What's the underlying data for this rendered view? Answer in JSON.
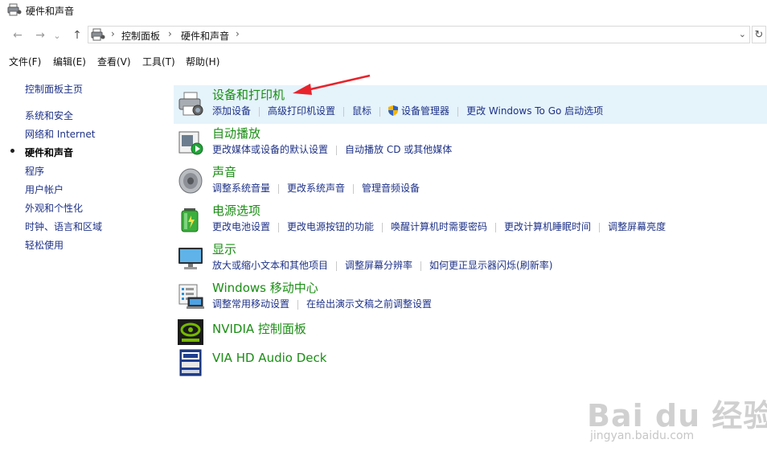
{
  "window": {
    "title": "硬件和声音",
    "title_icon": "printer-speaker-icon"
  },
  "nav": {
    "back_icon": "←",
    "forward_icon": "→",
    "recent_icon": "⌄",
    "up_icon": "↑",
    "breadcrumb": [
      "控制面板",
      "硬件和声音"
    ],
    "chevron": "›",
    "dropdown_icon": "⌄",
    "refresh_icon": "↻"
  },
  "menu": {
    "items": [
      "文件(F)",
      "编辑(E)",
      "查看(V)",
      "工具(T)",
      "帮助(H)"
    ]
  },
  "sidebar": {
    "items": [
      {
        "label": "控制面板主页"
      },
      {
        "label": "系统和安全"
      },
      {
        "label": "网络和 Internet"
      },
      {
        "label": "硬件和声音",
        "active": true
      },
      {
        "label": "程序"
      },
      {
        "label": "用户帐户"
      },
      {
        "label": "外观和个性化"
      },
      {
        "label": "时钟、语言和区域"
      },
      {
        "label": "轻松使用"
      }
    ]
  },
  "categories": [
    {
      "title": "设备和打印机",
      "icon": "printer-camera-icon",
      "links": [
        "添加设备",
        "高级打印机设置",
        "鼠标",
        "设备管理器",
        "更改 Windows To Go 启动选项"
      ]
    },
    {
      "title": "自动播放",
      "icon": "autoplay-icon",
      "links": [
        "更改媒体或设备的默认设置",
        "自动播放 CD 或其他媒体"
      ]
    },
    {
      "title": "声音",
      "icon": "speaker-icon",
      "links": [
        "调整系统音量",
        "更改系统声音",
        "管理音频设备"
      ]
    },
    {
      "title": "电源选项",
      "icon": "battery-icon",
      "links": [
        "更改电池设置",
        "更改电源按钮的功能",
        "唤醒计算机时需要密码",
        "更改计算机睡眠时间",
        "调整屏幕亮度"
      ]
    },
    {
      "title": "显示",
      "icon": "monitor-icon",
      "links": [
        "放大或缩小文本和其他项目",
        "调整屏幕分辨率",
        "如何更正显示器闪烁(刷新率)"
      ]
    },
    {
      "title": "Windows 移动中心",
      "icon": "mobility-center-icon",
      "links": [
        "调整常用移动设置",
        "在给出演示文稿之前调整设置"
      ]
    },
    {
      "title": "NVIDIA 控制面板",
      "icon": "nvidia-icon",
      "links": []
    },
    {
      "title": "VIA HD Audio Deck",
      "icon": "via-audio-icon",
      "links": []
    }
  ],
  "colors": {
    "category_title": "#1a8e14",
    "link": "#1e3287",
    "highlight": "#e5f3fb",
    "annotation_arrow": "#e8232b"
  },
  "watermark": {
    "logo": "Bai du 经验",
    "url": "jingyan.baidu.com"
  }
}
